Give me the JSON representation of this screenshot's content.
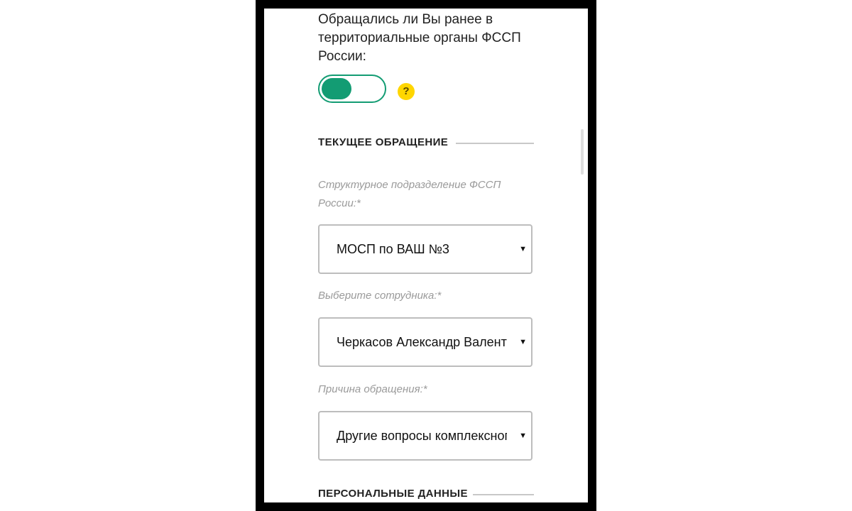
{
  "question": {
    "text": "Обращались ли Вы ранее в территориальные органы ФССП России:",
    "toggle_state": "on",
    "help_icon": "?"
  },
  "sections": {
    "current": "ТЕКУЩЕЕ ОБРАЩЕНИЕ",
    "personal": "ПЕРСОНАЛЬНЫЕ ДАННЫЕ"
  },
  "fields": [
    {
      "label": "Структурное подразделение ФССП России:*",
      "value": "МОСП по ВАШ №3"
    },
    {
      "label": "Выберите сотрудника:*",
      "value": "Черкасов Александр Валентинович"
    },
    {
      "label": "Причина обращения:*",
      "value": "Другие вопросы комплексного характера"
    }
  ],
  "icons": {
    "dropdown": "chevron-down-icon",
    "help": "question-icon"
  },
  "colors": {
    "accent": "#139c73",
    "help": "#ffd600"
  }
}
